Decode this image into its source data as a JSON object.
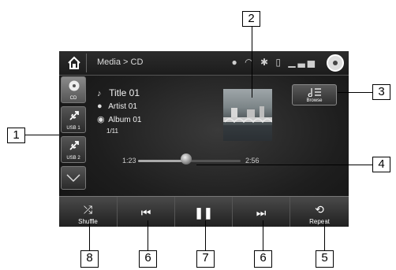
{
  "statusbar": {
    "breadcrumb": "Media > CD",
    "icons": [
      "home-icon",
      "signal-icon",
      "wifi-icon",
      "bluetooth-icon",
      "battery-icon",
      "cell-signal-icon",
      "cd-icon"
    ]
  },
  "sources": [
    {
      "label": "CD",
      "icon": "cd-icon"
    },
    {
      "label": "USB 1",
      "icon": "usb-icon"
    },
    {
      "label": "USB 2",
      "icon": "usb-icon"
    }
  ],
  "track": {
    "title": "Title 01",
    "artist": "Artist 01",
    "album": "Album 01",
    "position": "1/11"
  },
  "browse": {
    "label": "Browse",
    "icon": "browse-list-icon"
  },
  "progress": {
    "elapsed": "1:23",
    "total": "2:56",
    "fraction": 0.47
  },
  "controls": [
    {
      "label": "Shuffle",
      "icon": "shuffle-icon"
    },
    {
      "label": "",
      "icon": "skip-previous-icon"
    },
    {
      "label": "",
      "icon": "pause-icon"
    },
    {
      "label": "",
      "icon": "skip-next-icon"
    },
    {
      "label": "Repeat",
      "icon": "repeat-icon"
    }
  ],
  "callouts": [
    "1",
    "2",
    "3",
    "4",
    "5",
    "6",
    "7",
    "6",
    "8"
  ],
  "colors": {
    "screen": "#1e1e1e",
    "text": "#ffffff",
    "callout_border": "#000000"
  }
}
